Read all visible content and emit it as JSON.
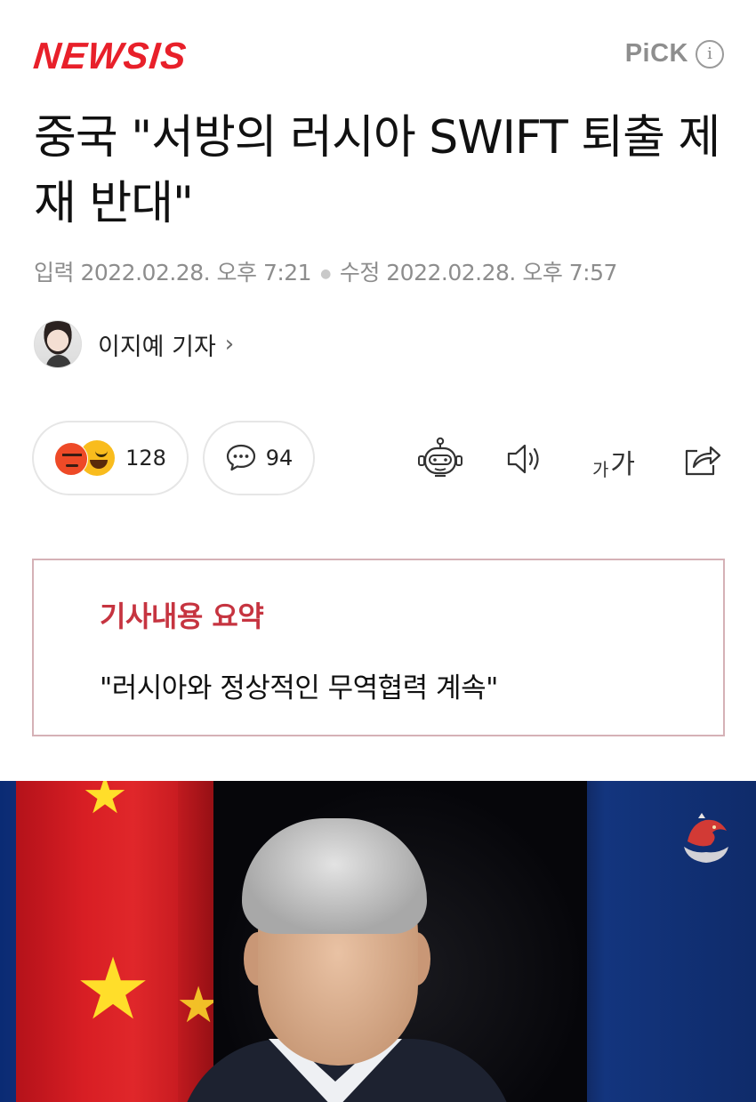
{
  "header": {
    "logo": "NEWSIS",
    "pick_label": "PiCK",
    "info_glyph": "i"
  },
  "article": {
    "headline": "중국 \"서방의 러시아 SWIFT 퇴출 제재 반대\"",
    "input_label": "입력",
    "input_date": "2022.02.28. 오후 7:21",
    "modified_label": "수정",
    "modified_date": "2022.02.28. 오후 7:57",
    "author": "이지예 기자",
    "author_chevron": "›"
  },
  "actions": {
    "reaction_count": "128",
    "comment_count": "94",
    "font_small": "가",
    "font_large": "가",
    "icons": [
      "robot-icon",
      "speaker-icon",
      "font-size-icon",
      "share-icon"
    ]
  },
  "summary": {
    "title": "기사내용 요약",
    "items": [
      "\"러시아와 정상적인 무역협력 계속\""
    ]
  },
  "colors": {
    "brand_red": "#e8202a",
    "summary_title": "#c63440",
    "summary_border": "#d5b1b6",
    "meta_gray": "#8d8d8d"
  }
}
